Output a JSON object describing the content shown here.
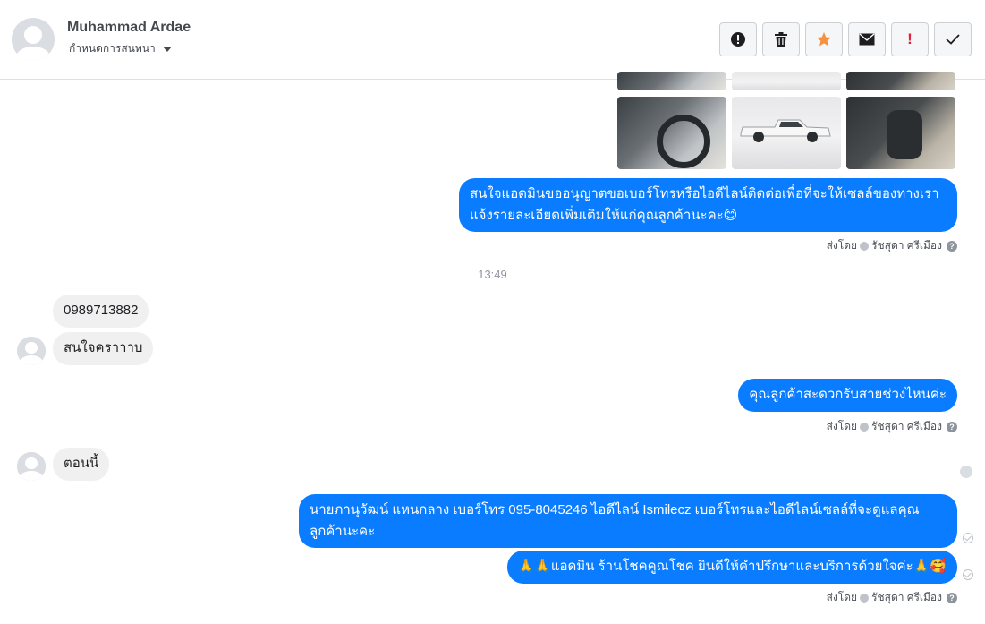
{
  "header": {
    "contact_name": "Muhammad Ardae",
    "assign_label": "กำหนดการสนทนา",
    "toolbar": [
      {
        "icon": "alert-circle-icon",
        "label": ""
      },
      {
        "icon": "trash-icon",
        "label": ""
      },
      {
        "icon": "star-icon",
        "label": ""
      },
      {
        "icon": "envelope-icon",
        "label": ""
      },
      {
        "icon": "exclamation-icon",
        "label": "!"
      },
      {
        "icon": "check-icon",
        "label": ""
      }
    ]
  },
  "colors": {
    "outgoing_bubble": "#0a7cff",
    "incoming_bubble": "#f1f0f0",
    "star": "#f5923e",
    "exclamation": "#e41e3f"
  },
  "messages": {
    "msg1": "สนใจแอดมินขออนุญาตขอเบอร์โทรหรือไอดีไลน์ติดต่อเพื่อที่จะให้เซลล์ของทางเรา แจ้งรายละเอียดเพิ่มเติมให้แก่คุณลูกค้านะคะ😊",
    "time_divider": "13:49",
    "msg2": "0989713882",
    "msg3": "สนใจคราาาบ",
    "msg4": "คุณลูกค้าสะดวกรับสายช่วงไหนค่ะ",
    "msg5": "ตอนนี้",
    "msg6": "นายภานุวัฒน์ แหนกลาง เบอร์โทร 095-8045246 ไอดีไลน์ Ismilecz  เบอร์โทรและไอดีไลน์เซลล์ที่จะดูแลคุณลูกค้านะคะ",
    "msg7": "🙏🙏แอดมิน ร้านโชคคูณโชค ยินดีให้คำปรึกษาและบริการด้วยใจค่ะ🙏🥰"
  },
  "sent_by": {
    "prefix": "ส่งโดย",
    "agent": "รัชสุดา ศรีเมือง",
    "help": "?"
  }
}
